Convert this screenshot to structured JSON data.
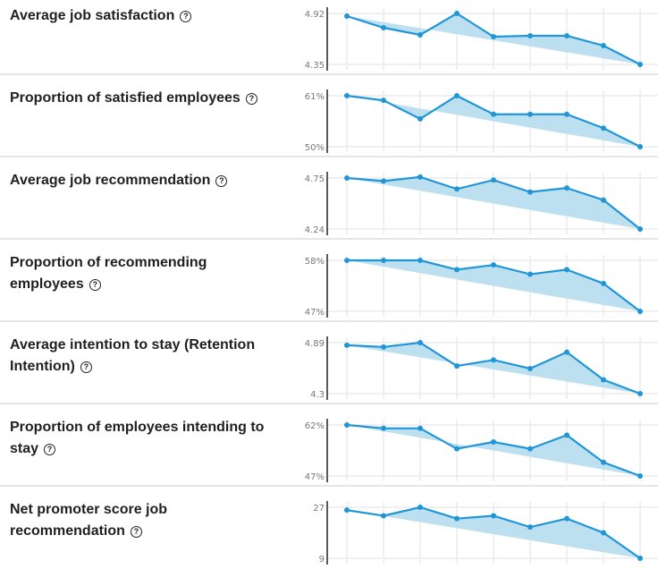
{
  "colors": {
    "line": "#2196d6",
    "fill": "#bde0f1",
    "grid": "#ebebeb",
    "axis": "#222222"
  },
  "help_icon": "question-circle-icon",
  "chart_data": [
    {
      "type": "line",
      "title": "Average job satisfaction",
      "yticks": [
        "4.92",
        "4.35"
      ],
      "ylim": [
        4.35,
        4.92
      ],
      "values": [
        4.89,
        4.76,
        4.68,
        4.92,
        4.66,
        4.67,
        4.67,
        4.56,
        4.35
      ]
    },
    {
      "type": "line",
      "title": "Proportion of satisfied employees",
      "yticks": [
        "61%",
        "50%"
      ],
      "ylim": [
        50,
        61
      ],
      "values": [
        61,
        60,
        56,
        61,
        57,
        57,
        57,
        54,
        50
      ]
    },
    {
      "type": "line",
      "title": "Average job recommendation",
      "yticks": [
        "4.75",
        "4.24"
      ],
      "ylim": [
        4.24,
        4.75
      ],
      "values": [
        4.75,
        4.72,
        4.76,
        4.64,
        4.73,
        4.61,
        4.65,
        4.53,
        4.24
      ]
    },
    {
      "type": "line",
      "title": "Proportion of recommending employees",
      "yticks": [
        "58%",
        "47%"
      ],
      "ylim": [
        47,
        58
      ],
      "values": [
        58,
        58,
        58,
        56,
        57,
        55,
        56,
        53,
        47
      ]
    },
    {
      "type": "line",
      "title": "Average intention to stay (Retention Intention)",
      "yticks": [
        "4.89",
        "4.3"
      ],
      "ylim": [
        4.3,
        4.89
      ],
      "values": [
        4.86,
        4.84,
        4.89,
        4.62,
        4.69,
        4.59,
        4.78,
        4.46,
        4.3
      ]
    },
    {
      "type": "line",
      "title": "Proportion of employees intending to stay",
      "yticks": [
        "62%",
        "47%"
      ],
      "ylim": [
        47,
        62
      ],
      "values": [
        62,
        61,
        61,
        55,
        57,
        55,
        59,
        51,
        47
      ]
    },
    {
      "type": "line",
      "title": "Net promoter score job recommendation",
      "yticks": [
        "27",
        "9"
      ],
      "ylim": [
        9,
        27
      ],
      "values": [
        26,
        24,
        27,
        23,
        24,
        20,
        23,
        18,
        9
      ]
    }
  ]
}
